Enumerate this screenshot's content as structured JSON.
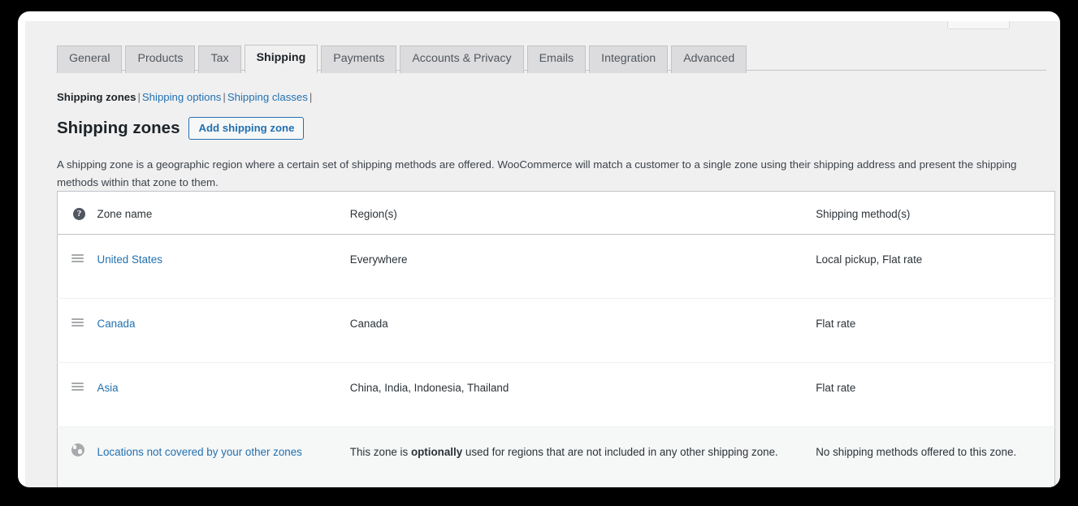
{
  "tabs": [
    {
      "label": "General",
      "active": false
    },
    {
      "label": "Products",
      "active": false
    },
    {
      "label": "Tax",
      "active": false
    },
    {
      "label": "Shipping",
      "active": true
    },
    {
      "label": "Payments",
      "active": false
    },
    {
      "label": "Accounts & Privacy",
      "active": false
    },
    {
      "label": "Emails",
      "active": false
    },
    {
      "label": "Integration",
      "active": false
    },
    {
      "label": "Advanced",
      "active": false
    }
  ],
  "subnav": {
    "current": "Shipping zones",
    "sep": "|",
    "links": [
      "Shipping options",
      "Shipping classes"
    ]
  },
  "header": {
    "title": "Shipping zones",
    "add_button": "Add shipping zone",
    "description": "A shipping zone is a geographic region where a certain set of shipping methods are offered. WooCommerce will match a customer to a single zone using their shipping address and present the shipping methods within that zone to them."
  },
  "table": {
    "columns": {
      "sort": "",
      "name": "Zone name",
      "region": "Region(s)",
      "method": "Shipping method(s)"
    },
    "help_icon": "?",
    "rows": [
      {
        "icon": "drag-handle-icon",
        "name": "United States",
        "region": "Everywhere",
        "method": "Local pickup, Flat rate"
      },
      {
        "icon": "drag-handle-icon",
        "name": "Canada",
        "region": "Canada",
        "method": "Flat rate"
      },
      {
        "icon": "drag-handle-icon",
        "name": "Asia",
        "region": "China, India, Indonesia, Thailand",
        "method": "Flat rate"
      }
    ],
    "worldwide_row": {
      "icon": "globe-icon",
      "name": "Locations not covered by your other zones",
      "region_before": "This zone is ",
      "region_bold": "optionally",
      "region_after": " used for regions that are not included in any other shipping zone.",
      "method": "No shipping methods offered to this zone."
    }
  },
  "colors": {
    "link": "#2271b1",
    "page_background": "#f0f0f1",
    "table_background": "#ffffff",
    "worldwide_row_background": "#f6f7f7",
    "tab_inactive": "#dcdcde",
    "border": "#c3c4c7",
    "text": "#2c3338"
  }
}
